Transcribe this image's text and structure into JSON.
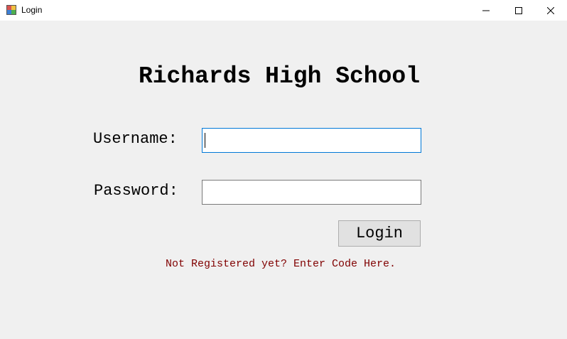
{
  "window": {
    "title": "Login",
    "icon": "app-icon",
    "controls": {
      "minimize": "minimize-icon",
      "maximize": "maximize-icon",
      "close": "close-icon"
    }
  },
  "form": {
    "heading": "Richards High School",
    "username": {
      "label": "Username:",
      "value": "",
      "placeholder": ""
    },
    "password": {
      "label": "Password:",
      "value": "",
      "placeholder": ""
    },
    "login_label": "Login",
    "register_link": "Not Registered yet? Enter Code Here."
  },
  "colors": {
    "background": "#f0f0f0",
    "link": "#800000",
    "focus_border": "#0078d7",
    "button_face": "#e1e1e1"
  }
}
